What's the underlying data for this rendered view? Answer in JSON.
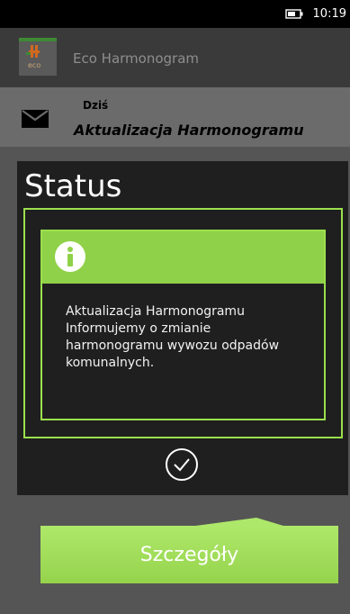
{
  "status_bar": {
    "time": "10:19",
    "battery_icon": "battery-icon"
  },
  "header": {
    "app_title": "Eco Harmonogram",
    "logo_text": "eco",
    "logo_icon": "app-logo-icon"
  },
  "message": {
    "date_label": "Dziś",
    "subject": "Aktualizacja Harmonogramu",
    "icon": "envelope-icon"
  },
  "dialog": {
    "title": "Status",
    "card_icon": "info-icon",
    "message_lines": [
      "Aktualizacja Harmonogramu",
      "Informujemy o zmianie",
      "harmonogramu wywozu odpadów",
      "komunalnych."
    ],
    "confirm_icon": "checkmark-circle-icon"
  },
  "details_button": {
    "label": "Szczegóły"
  },
  "colors": {
    "accent_green": "#8fd148",
    "dialog_bg": "#1f1f1f",
    "border_green": "#9be04d"
  }
}
